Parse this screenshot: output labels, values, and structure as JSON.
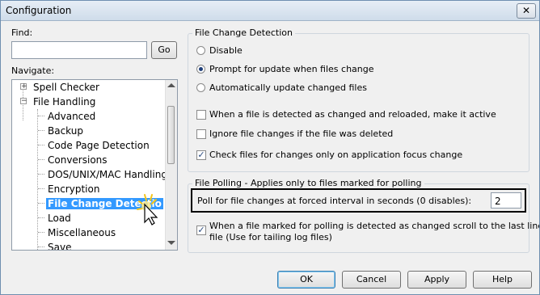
{
  "window": {
    "title": "Configuration",
    "close_glyph": "✕"
  },
  "find": {
    "label": "Find:",
    "value": "",
    "go_label": "Go"
  },
  "navigate": {
    "label": "Navigate:",
    "items": [
      {
        "label": "Spell Checker",
        "level": 0,
        "expander": "+"
      },
      {
        "label": "File Handling",
        "level": 0,
        "expander": "−"
      },
      {
        "label": "Advanced",
        "level": 1
      },
      {
        "label": "Backup",
        "level": 1
      },
      {
        "label": "Code Page Detection",
        "level": 1
      },
      {
        "label": "Conversions",
        "level": 1
      },
      {
        "label": "DOS/UNIX/MAC Handling",
        "level": 1
      },
      {
        "label": "Encryption",
        "level": 1
      },
      {
        "label": "File Change Detectio",
        "level": 1,
        "selected": true
      },
      {
        "label": "Load",
        "level": 1
      },
      {
        "label": "Miscellaneous",
        "level": 1
      },
      {
        "label": "Save",
        "level": 1
      }
    ]
  },
  "file_change_detection": {
    "title": "File Change Detection",
    "radios": [
      {
        "label": "Disable",
        "checked": false
      },
      {
        "label": "Prompt for update when files change",
        "checked": true
      },
      {
        "label": "Automatically update changed files",
        "checked": false
      }
    ],
    "checkboxes": [
      {
        "label": "When a file is detected as changed and reloaded, make it active",
        "checked": false
      },
      {
        "label": "Ignore file changes if the file was deleted",
        "checked": false
      },
      {
        "label": "Check files for changes only on application focus change",
        "checked": true
      }
    ]
  },
  "file_polling": {
    "title": "File Polling - Applies only to files marked for polling",
    "interval_label": "Poll for file changes at forced interval in seconds (0 disables):",
    "interval_value": "2",
    "scroll_label_line1": "When a file marked for polling is detected as changed scroll to the last line in the",
    "scroll_label_line2": "file (Use for tailing log files)",
    "scroll_checked": true
  },
  "buttons": {
    "ok": "OK",
    "cancel": "Cancel",
    "apply": "Apply",
    "help": "Help"
  }
}
